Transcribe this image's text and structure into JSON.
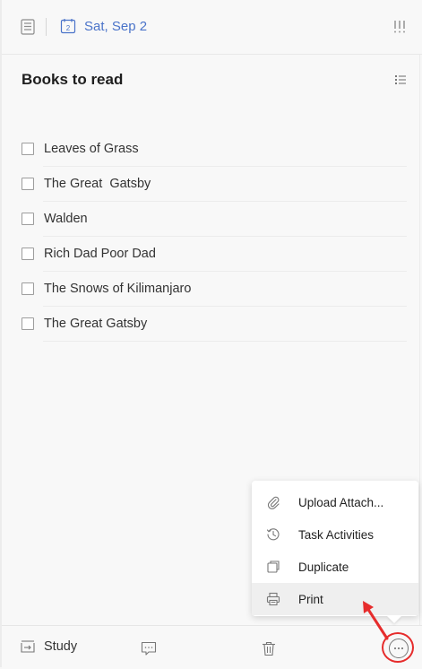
{
  "header": {
    "date_label": "Sat, Sep 2",
    "calendar_day": "2",
    "priority_icon": "priority-icon"
  },
  "task": {
    "title": "Books to read",
    "items": [
      {
        "label": "Leaves of Grass",
        "checked": false
      },
      {
        "label": "The Great  Gatsby",
        "checked": false
      },
      {
        "label": "Walden",
        "checked": false
      },
      {
        "label": "Rich Dad Poor Dad",
        "checked": false
      },
      {
        "label": "The Snows of Kilimanjaro",
        "checked": false
      },
      {
        "label": "The Great Gatsby",
        "checked": false
      }
    ]
  },
  "menu": {
    "items": [
      {
        "label": "Upload Attach...",
        "icon": "paperclip-icon"
      },
      {
        "label": "Task Activities",
        "icon": "history-icon"
      },
      {
        "label": "Duplicate",
        "icon": "duplicate-icon"
      },
      {
        "label": "Print",
        "icon": "printer-icon"
      }
    ]
  },
  "footer": {
    "list_name": "Study"
  },
  "colors": {
    "accent": "#4a73c9",
    "highlight": "#e62c2c"
  }
}
